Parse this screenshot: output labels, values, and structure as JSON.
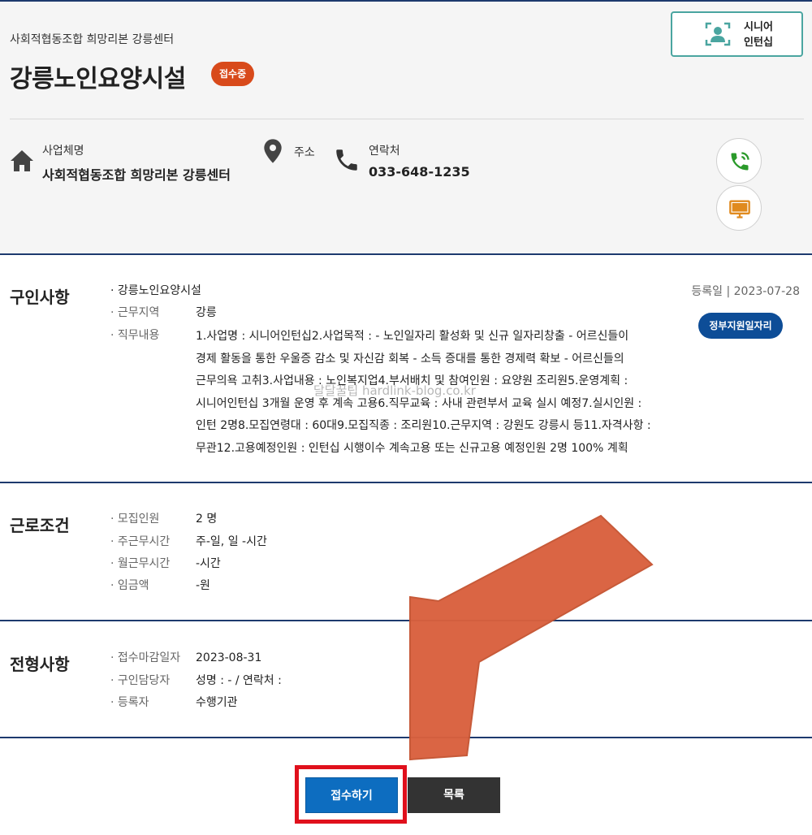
{
  "header": {
    "org_name": "사회적협동조합 희망리본 강릉센터",
    "title": "강릉노인요양시설",
    "status": "접수중",
    "senior_button": {
      "line1": "시니어",
      "line2": "인턴십"
    },
    "business": {
      "label": "사업체명",
      "value": "사회적협동조합 희망리본 강릉센터"
    },
    "address": {
      "label": "주소"
    },
    "contact": {
      "label": "연락처",
      "value": "033-648-1235"
    }
  },
  "job": {
    "section_title": "구인사항",
    "name": "· 강릉노인요양시설",
    "work_area_key": "· 근무지역",
    "work_area_value": "강릉",
    "duty_key": "· 직무내용",
    "duty_lines": [
      "1.사업명 : 시니어인턴십2.사업목적 : - 노인일자리 활성화 및 신규 일자리창출 - 어르신들이",
      "경제 활동을 통한 우울증 감소 및 자신감 회복 - 소득 증대를 통한 경제력 확보 - 어르신들의",
      "근무의욕 고취3.사업내용 : 노인복지업4.부서배치 및 참여인원 : 요양원 조리원5.운영계획 :",
      "시니어인턴십 3개월 운영 후 계속 고용6.직무교육 : 사내 관련부서 교육 실시 예정7.실시인원 :",
      "인턴 2명8.모집연령대 : 60대9.모집직종 : 조리원10.근무지역 : 강원도 강릉시 등11.자격사항 :",
      "무관12.고용예정인원 : 인턴십 시행이수 계속고용 또는 신규고용 예정인원 2명 100% 계획"
    ],
    "registered": "등록일  |  2023-07-28",
    "badge": "정부지원일자리"
  },
  "conditions": {
    "section_title": "근로조건",
    "rows": [
      {
        "key": "· 모집인원",
        "value": "2 명"
      },
      {
        "key": "· 주근무시간",
        "value": "주-일, 일 -시간"
      },
      {
        "key": "· 월근무시간",
        "value": "-시간"
      },
      {
        "key": "· 임금액",
        "value": "-원"
      }
    ]
  },
  "screening": {
    "section_title": "전형사항",
    "rows": [
      {
        "key": "· 접수마감일자",
        "value": "2023-08-31"
      },
      {
        "key": "· 구인담당자",
        "value": "성명 : - / 연락처 :"
      },
      {
        "key": "· 등록자",
        "value": "수행기관"
      }
    ]
  },
  "watermark": "달달꿀팁 hardlink-blog.co.kr",
  "buttons": {
    "apply": "접수하기",
    "list": "목록"
  },
  "colors": {
    "navy": "#1d3a6e",
    "status": "#d84a1b",
    "gov_badge": "#0d4d97",
    "apply": "#0d6dc0",
    "arrow": "#d9613e",
    "highlight": "#e0101c"
  }
}
